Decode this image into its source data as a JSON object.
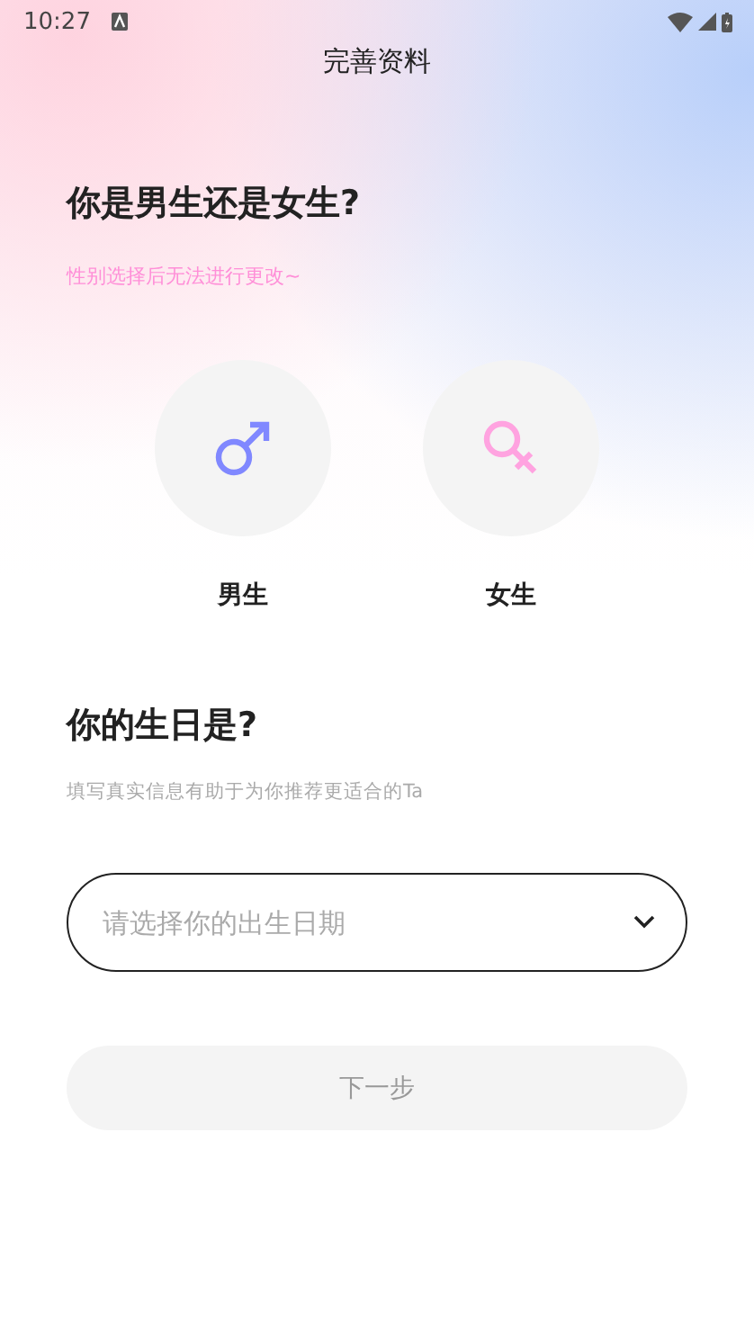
{
  "status_bar": {
    "time": "10:27"
  },
  "header": {
    "title": "完善资料"
  },
  "gender_section": {
    "heading": "你是男生还是女生?",
    "hint": "性别选择后无法进行更改~",
    "options": [
      {
        "kind": "male",
        "label": "男生",
        "selected": false
      },
      {
        "kind": "female",
        "label": "女生",
        "selected": false
      }
    ]
  },
  "birthday_section": {
    "heading": "你的生日是?",
    "hint": "填写真实信息有助于为你推荐更适合的Ta",
    "date_field": {
      "placeholder": "请选择你的出生日期"
    }
  },
  "next_button": {
    "label": "下一步",
    "disabled": true
  }
}
